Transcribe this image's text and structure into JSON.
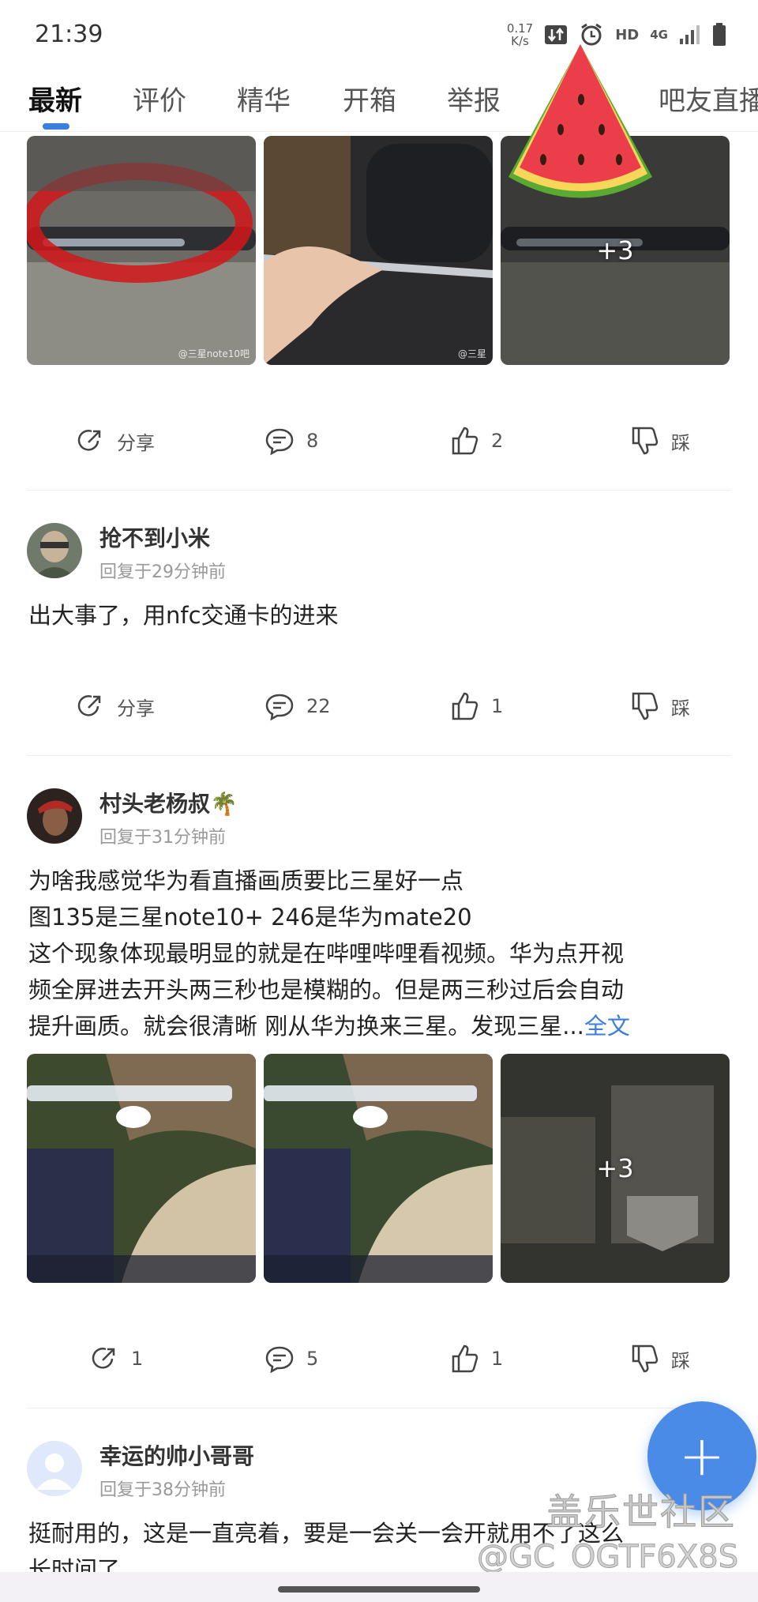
{
  "status_bar": {
    "time": "21:39",
    "net_speed_value": "0.17",
    "net_speed_unit": "K/s",
    "hd": "HD",
    "network": "4G"
  },
  "tabs": [
    {
      "label": "最新",
      "active": true
    },
    {
      "label": "评价",
      "active": false
    },
    {
      "label": "精华",
      "active": false
    },
    {
      "label": "开箱",
      "active": false
    },
    {
      "label": "举报",
      "active": false
    },
    {
      "label": "吧友直播",
      "active": false
    }
  ],
  "post1": {
    "more_images": "+3",
    "watermark_1": "@三星note10吧",
    "watermark_2": "@三星",
    "actions": {
      "share": "分享",
      "comments": "8",
      "likes": "2",
      "dislike": "踩"
    }
  },
  "post2": {
    "username": "抢不到小米",
    "time": "回复于29分钟前",
    "text": "出大事了，用nfc交通卡的进来",
    "actions": {
      "share": "分享",
      "comments": "22",
      "likes": "1",
      "dislike": "踩"
    }
  },
  "post3": {
    "username": "村头老杨叔🌴",
    "time": "回复于31分钟前",
    "lines": [
      "为啥我感觉华为看直播画质要比三星好一点",
      "图135是三星note10+ 246是华为mate20",
      "这个现象体现最明显的就是在哔哩哔哩看视频。华为点开视",
      "频全屏进去开头两三秒也是模糊的。但是两三秒过后会自动",
      "提升画质。就会很清晰 刚从华为换来三星。发现三星..."
    ],
    "full_text_link": "全文",
    "more_images": "+3",
    "actions": {
      "shares": "1",
      "comments": "5",
      "likes": "1",
      "dislike": "踩"
    }
  },
  "post4": {
    "username": "幸运的帅小哥哥",
    "time": "回复于38分钟前",
    "text_line1": "挺耐用的，这是一直亮着，要是一会关一会开就用不了这么",
    "text_line2": "长时间了"
  },
  "fab": {
    "label": "+"
  },
  "watermarks": {
    "line1": "盖乐世社区",
    "line2": "@GC_OGTF6X8S"
  },
  "colors": {
    "accent": "#3b7ee0",
    "fab": "#4a8be8"
  }
}
